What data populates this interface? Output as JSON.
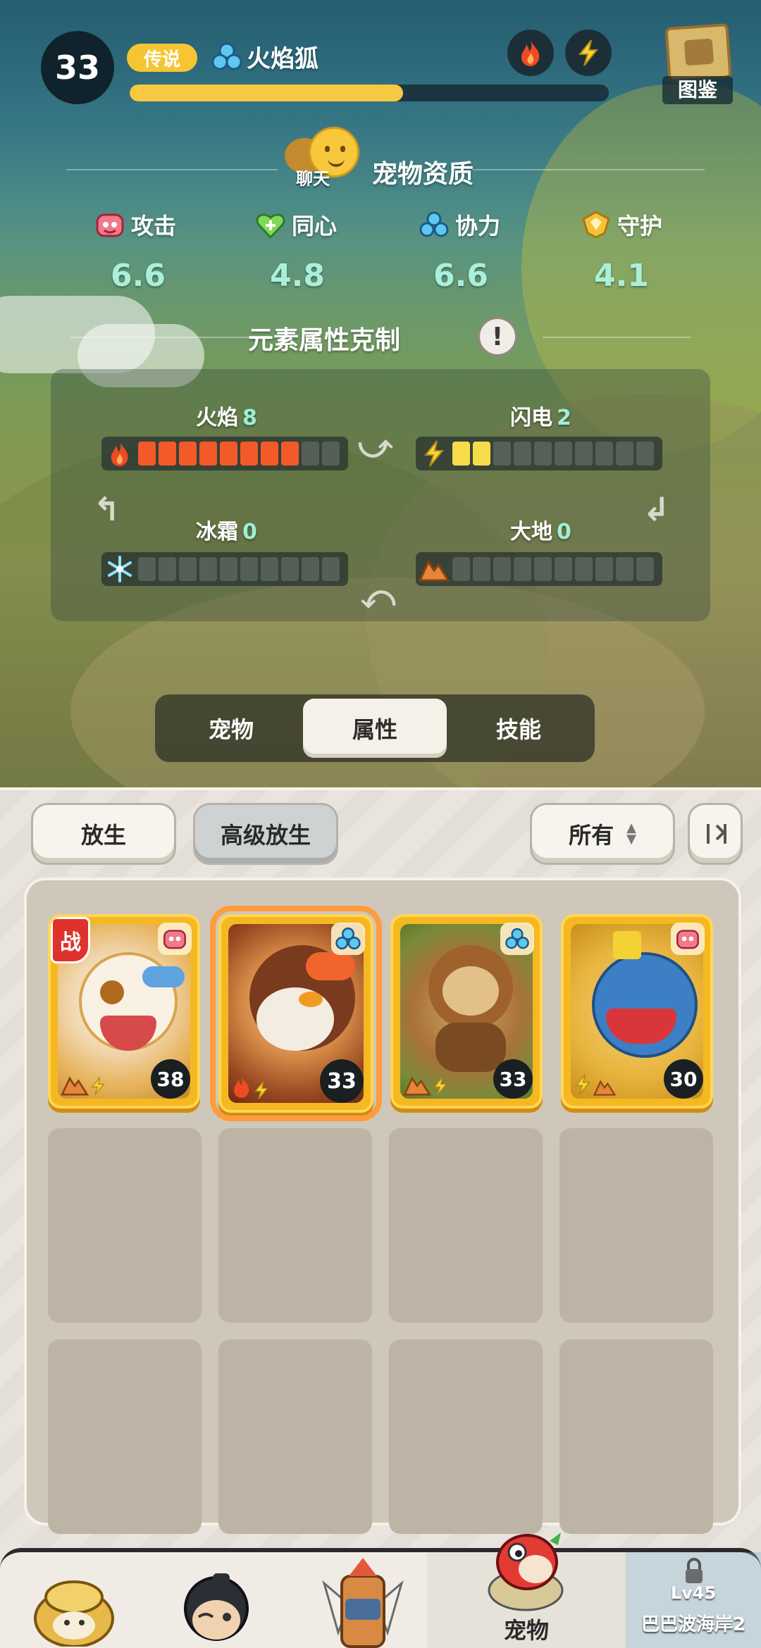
{
  "header": {
    "level": "33",
    "rarity": "传说",
    "pet_name": "火焰狐",
    "exp_progress": 0.57,
    "codex_label": "图鉴",
    "element_icons": [
      "fire-icon",
      "lightning-icon"
    ]
  },
  "aptitude": {
    "chat_label": "聊天",
    "title": "宠物资质",
    "stats": [
      {
        "label": "攻击",
        "value": "6.6",
        "icon": "attack-icon"
      },
      {
        "label": "同心",
        "value": "4.8",
        "icon": "heart-icon"
      },
      {
        "label": "协力",
        "value": "6.6",
        "icon": "cooperation-icon"
      },
      {
        "label": "守护",
        "value": "4.1",
        "icon": "guard-icon"
      }
    ]
  },
  "elements": {
    "title": "元素属性克制",
    "info_icon": "!",
    "bars": [
      {
        "name": "火焰",
        "value": "8",
        "level": 8,
        "max": 10,
        "icon": "fire-icon"
      },
      {
        "name": "闪电",
        "value": "2",
        "level": 2,
        "max": 10,
        "icon": "lightning-icon"
      },
      {
        "name": "冰霜",
        "value": "0",
        "level": 0,
        "max": 10,
        "icon": "snowflake-icon"
      },
      {
        "name": "大地",
        "value": "0",
        "level": 0,
        "max": 10,
        "icon": "earth-icon"
      }
    ]
  },
  "tabs": [
    {
      "label": "宠物",
      "active": false
    },
    {
      "label": "属性",
      "active": true
    },
    {
      "label": "技能",
      "active": false
    }
  ],
  "actions": {
    "release": "放生",
    "advanced_release": "高级放生",
    "filter": "所有",
    "sort_icon": "sort-icon"
  },
  "pets": [
    {
      "level": "38",
      "battle": "战",
      "type_icon": "attack-icon",
      "elements": [
        "earth-icon",
        "lightning-icon"
      ],
      "selected": false
    },
    {
      "level": "33",
      "battle": "",
      "type_icon": "cooperation-icon",
      "elements": [
        "fire-icon",
        "lightning-icon"
      ],
      "selected": true
    },
    {
      "level": "33",
      "battle": "",
      "type_icon": "cooperation-icon",
      "elements": [
        "earth-icon",
        "lightning-icon"
      ],
      "selected": false
    },
    {
      "level": "30",
      "battle": "",
      "type_icon": "attack-icon",
      "elements": [
        "lightning-icon",
        "earth-icon"
      ],
      "selected": false
    }
  ],
  "nav": {
    "items": [
      {
        "label": "",
        "icon": "hay-creature-icon"
      },
      {
        "label": "",
        "icon": "trainer-icon"
      },
      {
        "label": "",
        "icon": "totem-icon"
      },
      {
        "label": "宠物",
        "icon": "pet-icon",
        "active": true
      }
    ],
    "locked": {
      "level": "Lv45",
      "location": "巴巴波海岸2"
    }
  },
  "colors": {
    "accent_gold": "#f6c533",
    "stat_value": "#a9f0dc",
    "fire": "#f25a2a",
    "lightning": "#f7dc4a",
    "selected_outline": "#ff9c3b",
    "battle_badge": "#e0322c"
  }
}
